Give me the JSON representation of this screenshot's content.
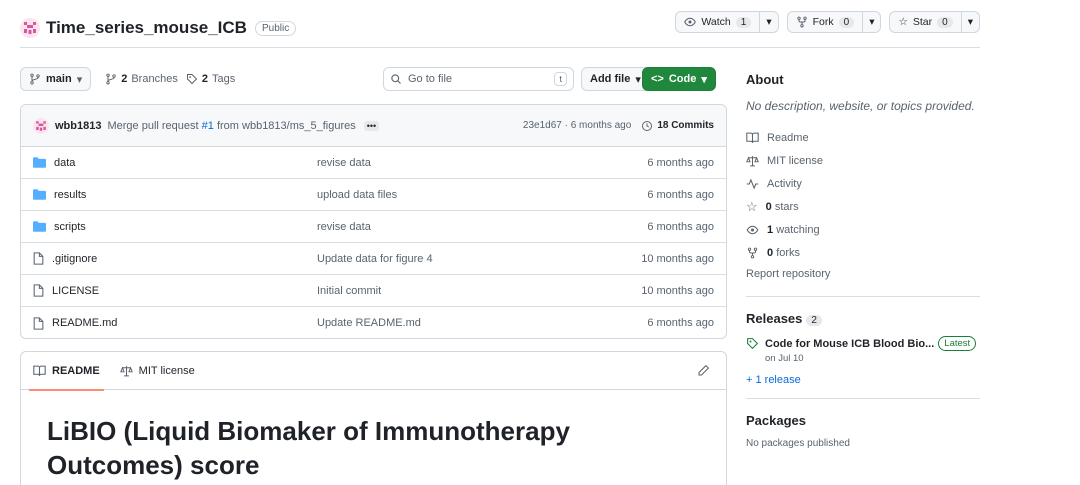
{
  "repo": {
    "name": "Time_series_mouse_ICB",
    "visibility": "Public",
    "watch_label": "Watch",
    "watch_count": "1",
    "fork_label": "Fork",
    "fork_count": "0",
    "star_label": "Star",
    "star_count": "0"
  },
  "toolbar": {
    "branch": "main",
    "branches_count": "2",
    "branches_label": "Branches",
    "tags_count": "2",
    "tags_label": "Tags",
    "search_placeholder": "Go to file",
    "search_key": "t",
    "add_file_label": "Add file",
    "code_label": "Code"
  },
  "commit": {
    "author": "wbb1813",
    "msg_prefix": "Merge pull request",
    "pr_link": "#1",
    "msg_suffix": "from wbb1813/ms_5_figures",
    "hash_time": "23e1d67 · 6 months ago",
    "commits_label": "18 Commits"
  },
  "files": [
    {
      "name": "data",
      "type": "folder",
      "message": "revise data",
      "age": "6 months ago"
    },
    {
      "name": "results",
      "type": "folder",
      "message": "upload data files",
      "age": "6 months ago"
    },
    {
      "name": "scripts",
      "type": "folder",
      "message": "revise data",
      "age": "6 months ago"
    },
    {
      "name": ".gitignore",
      "type": "file",
      "message": "Update data for figure 4",
      "age": "10 months ago"
    },
    {
      "name": "LICENSE",
      "type": "file",
      "message": "Initial commit",
      "age": "10 months ago"
    },
    {
      "name": "README.md",
      "type": "file",
      "message": "Update README.md",
      "age": "6 months ago"
    }
  ],
  "readme": {
    "tab_readme": "README",
    "tab_license": "MIT license",
    "title": "LiBIO (Liquid Biomaker of Immunotherapy Outcomes) score"
  },
  "about": {
    "heading": "About",
    "description": "No description, website, or topics provided.",
    "readme": "Readme",
    "license": "MIT license",
    "activity": "Activity",
    "stars_count": "0",
    "stars_label": "stars",
    "watching_count": "1",
    "watching_label": "watching",
    "forks_count": "0",
    "forks_label": "forks",
    "report": "Report repository"
  },
  "releases": {
    "heading": "Releases",
    "count": "2",
    "title": "Code for Mouse ICB Blood Bio...",
    "latest": "Latest",
    "date": "on Jul 10",
    "more": "+ 1 release"
  },
  "packages": {
    "heading": "Packages",
    "sub": "No packages published"
  },
  "colors": {
    "accent_green": "#1f883d",
    "link_blue": "#0969da",
    "folder_blue": "#54aeff",
    "tab_underline": "#fd8c73"
  }
}
